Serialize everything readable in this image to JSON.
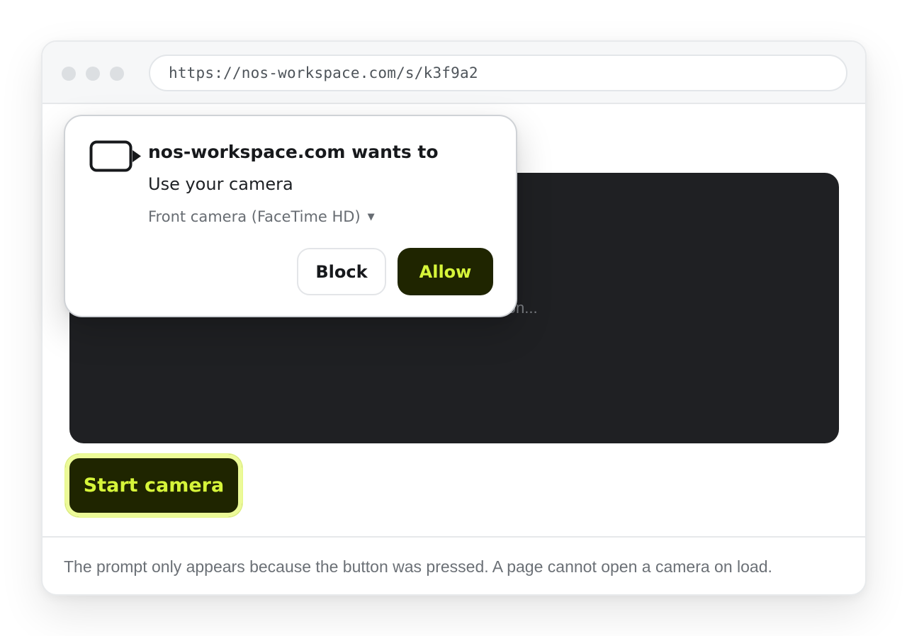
{
  "browser": {
    "url": "https://nos-workspace.com/s/k3f9a2"
  },
  "video": {
    "placeholder": "Waiting for permission..."
  },
  "start_button": {
    "label": "Start camera"
  },
  "footer": {
    "note": "The prompt only appears because the button was pressed. A page cannot open a camera on load."
  },
  "permission_prompt": {
    "title": "nos-workspace.com wants to",
    "description": "Use your camera",
    "device": "Front camera (FaceTime HD)",
    "device_caret": "▼",
    "block_label": "Block",
    "allow_label": "Allow",
    "icon": "video-camera-icon"
  },
  "colors": {
    "accent_dark": "#1f2500",
    "accent_lime": "#d6f53a",
    "video_bg": "#1f2023"
  }
}
